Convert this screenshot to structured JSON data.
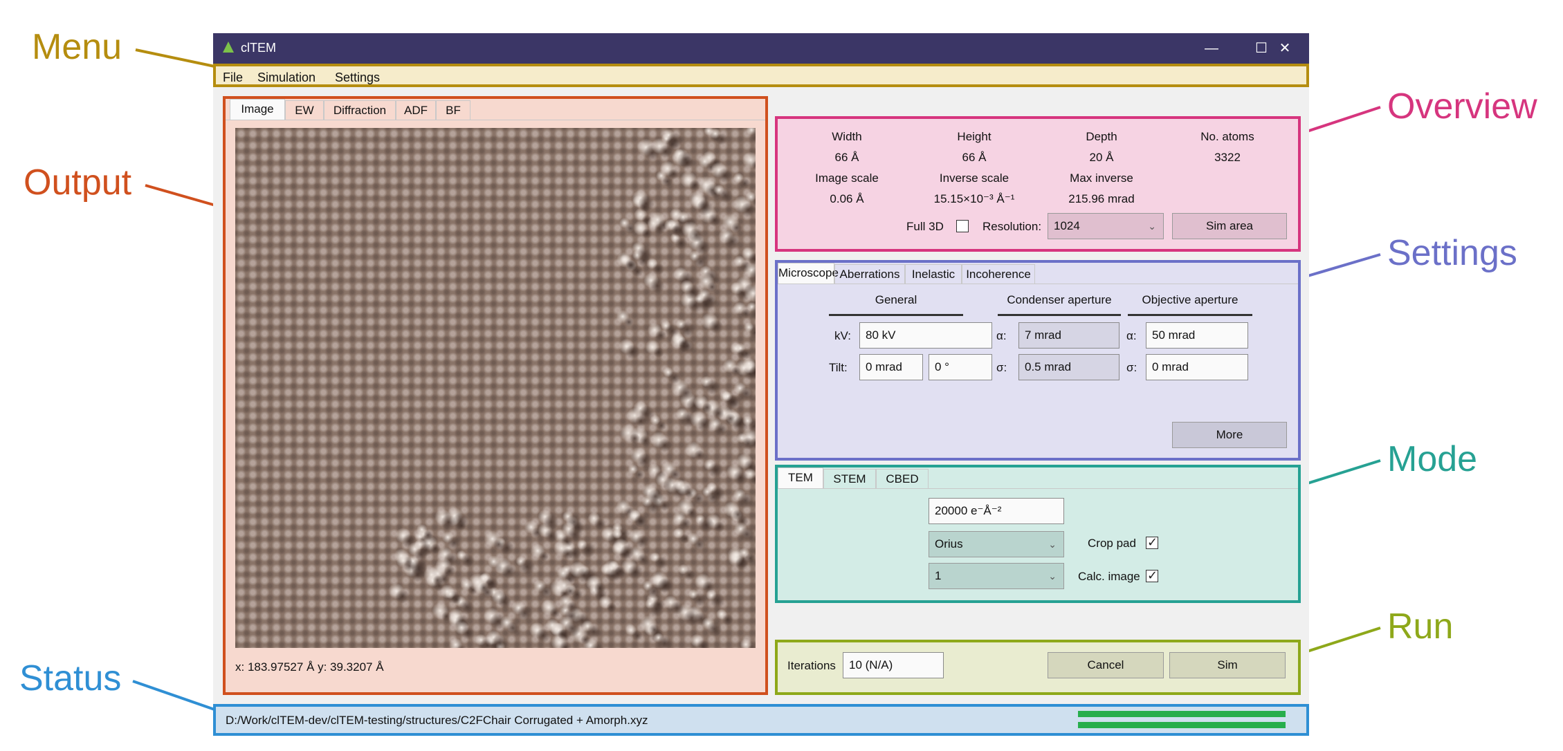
{
  "callouts": {
    "menu": {
      "label": "Menu",
      "color": "#b58d0f"
    },
    "output": {
      "label": "Output",
      "color": "#d0501e"
    },
    "status": {
      "label": "Status",
      "color": "#2f8fd4"
    },
    "overview": {
      "label": "Overview",
      "color": "#d6357e"
    },
    "settings": {
      "label": "Settings",
      "color": "#6b70c8"
    },
    "mode": {
      "label": "Mode",
      "color": "#26a193"
    },
    "run": {
      "label": "Run",
      "color": "#8ea81a"
    }
  },
  "window": {
    "title": "clTEM",
    "minimize": "—",
    "maximize": "☐",
    "close": "✕"
  },
  "menu": {
    "file": "File",
    "simulation": "Simulation",
    "settings": "Settings"
  },
  "output": {
    "tabs": [
      "Image",
      "EW",
      "Diffraction",
      "ADF",
      "BF"
    ],
    "active_tab": "Image",
    "coords": "x: 183.97527 Å  y: 39.3207 Å"
  },
  "overview": {
    "width_label": "Width",
    "width_value": "66 Å",
    "height_label": "Height",
    "height_value": "66 Å",
    "depth_label": "Depth",
    "depth_value": "20 Å",
    "atoms_label": "No. atoms",
    "atoms_value": "3322",
    "image_scale_label": "Image scale",
    "image_scale_value": "0.06 Å",
    "inverse_scale_label": "Inverse scale",
    "inverse_scale_value": "15.15×10⁻³ Å⁻¹",
    "max_inverse_label": "Max inverse",
    "max_inverse_value": "215.96 mrad",
    "full3d_label": "Full 3D",
    "full3d_checked": false,
    "resolution_label": "Resolution:",
    "resolution_value": "1024",
    "sim_area_button": "Sim area"
  },
  "settings": {
    "tabs": [
      "Microscope",
      "Aberrations",
      "Inelastic",
      "Incoherence"
    ],
    "active_tab": "Microscope",
    "general_header": "General",
    "condenser_header": "Condenser aperture",
    "objective_header": "Objective aperture",
    "kv_label": "kV:",
    "kv_value": "80 kV",
    "tilt_label": "Tilt:",
    "tilt_value": "0 mrad",
    "tilt_azimuth_value": "0 °",
    "cond_alpha_label": "α:",
    "cond_alpha_value": "7 mrad",
    "cond_sigma_label": "σ:",
    "cond_sigma_value": "0.5 mrad",
    "obj_alpha_label": "α:",
    "obj_alpha_value": "50 mrad",
    "obj_sigma_label": "σ:",
    "obj_sigma_value": "0 mrad",
    "more_button": "More"
  },
  "mode": {
    "tabs": [
      "TEM",
      "STEM",
      "CBED"
    ],
    "active_tab": "TEM",
    "dose_value": "20000 e⁻Å⁻²",
    "detector_value": "Orius",
    "binning_value": "1",
    "crop_pad_label": "Crop pad",
    "crop_pad_checked": true,
    "calc_image_label": "Calc. image",
    "calc_image_checked": true
  },
  "run": {
    "iterations_label": "Iterations",
    "iterations_value": "10 (N/A)",
    "cancel_button": "Cancel",
    "sim_button": "Sim"
  },
  "status": {
    "path": "D:/Work/clTEM-dev/clTEM-testing/structures/C2FChair Corrugated + Amorph.xyz",
    "progress_1": 1.0,
    "progress_2": 1.0
  }
}
